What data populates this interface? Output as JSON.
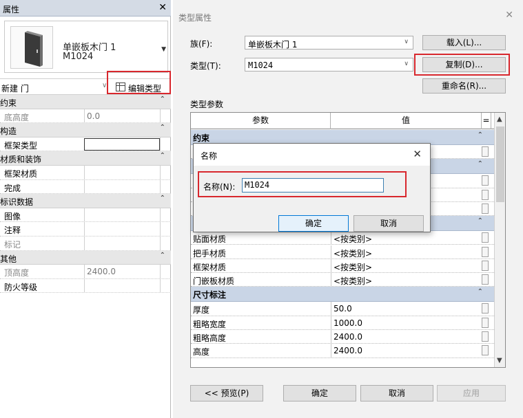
{
  "properties_panel": {
    "title": "属性",
    "close_glyph": "✕",
    "type_name_line1": "单嵌板木门 1",
    "type_name_line2": "M1024",
    "instance_label": "新建 门",
    "edit_type_label": "编辑类型",
    "rows": [
      {
        "kind": "cat",
        "name": "约束"
      },
      {
        "kind": "param",
        "name": "底高度",
        "value": "0.0",
        "gray": true
      },
      {
        "kind": "cat",
        "name": "构造"
      },
      {
        "kind": "param",
        "name": "框架类型",
        "value": "",
        "box": true
      },
      {
        "kind": "cat",
        "name": "材质和装饰"
      },
      {
        "kind": "param",
        "name": "框架材质",
        "value": ""
      },
      {
        "kind": "param",
        "name": "完成",
        "value": ""
      },
      {
        "kind": "cat",
        "name": "标识数据"
      },
      {
        "kind": "param",
        "name": "图像",
        "value": ""
      },
      {
        "kind": "param",
        "name": "注释",
        "value": ""
      },
      {
        "kind": "param",
        "name": "标记",
        "value": "",
        "gray": true
      },
      {
        "kind": "cat",
        "name": "其他"
      },
      {
        "kind": "param",
        "name": "顶高度",
        "value": "2400.0",
        "gray": true
      },
      {
        "kind": "param",
        "name": "防火等级",
        "value": ""
      }
    ]
  },
  "type_dialog": {
    "title": "类型属性",
    "family_label": "族(F):",
    "family_value": "单嵌板木门 1",
    "type_label": "类型(T):",
    "type_value": "M1024",
    "load_button": "载入(L)...",
    "duplicate_button": "复制(D)...",
    "rename_button": "重命名(R)...",
    "params_label": "类型参数",
    "col_param": "参数",
    "col_value": "值",
    "col_eq": "=",
    "rows": [
      {
        "kind": "cat",
        "name": "约束"
      },
      {
        "kind": "param",
        "name": "",
        "value": ""
      },
      {
        "kind": "cat",
        "name": ""
      },
      {
        "kind": "param",
        "name": "",
        "value": ""
      },
      {
        "kind": "param",
        "name": "",
        "value": ""
      },
      {
        "kind": "param",
        "name": "",
        "value": ""
      },
      {
        "kind": "cat",
        "name": ""
      },
      {
        "kind": "param",
        "name": "贴面材质",
        "value": "<按类别>"
      },
      {
        "kind": "param",
        "name": "把手材质",
        "value": "<按类别>"
      },
      {
        "kind": "param",
        "name": "框架材质",
        "value": "<按类别>"
      },
      {
        "kind": "param",
        "name": "门嵌板材质",
        "value": "<按类别>"
      },
      {
        "kind": "cat",
        "name": "尺寸标注"
      },
      {
        "kind": "param",
        "name": "厚度",
        "value": "50.0"
      },
      {
        "kind": "param",
        "name": "粗略宽度",
        "value": "1000.0"
      },
      {
        "kind": "param",
        "name": "粗略高度",
        "value": "2400.0"
      },
      {
        "kind": "param",
        "name": "高度",
        "value": "2400.0"
      }
    ],
    "preview_button": "<< 预览(P)",
    "ok_button": "确定",
    "cancel_button": "取消",
    "apply_button": "应用"
  },
  "name_dialog": {
    "title": "名称",
    "close_glyph": "✕",
    "label": "名称(N):",
    "input_value": "M1024",
    "ok_button": "确定",
    "cancel_button": "取消"
  },
  "colors": {
    "highlight": "#d8272d",
    "category_blue": "#c9d5e6",
    "focus_blue": "#0078d7"
  }
}
